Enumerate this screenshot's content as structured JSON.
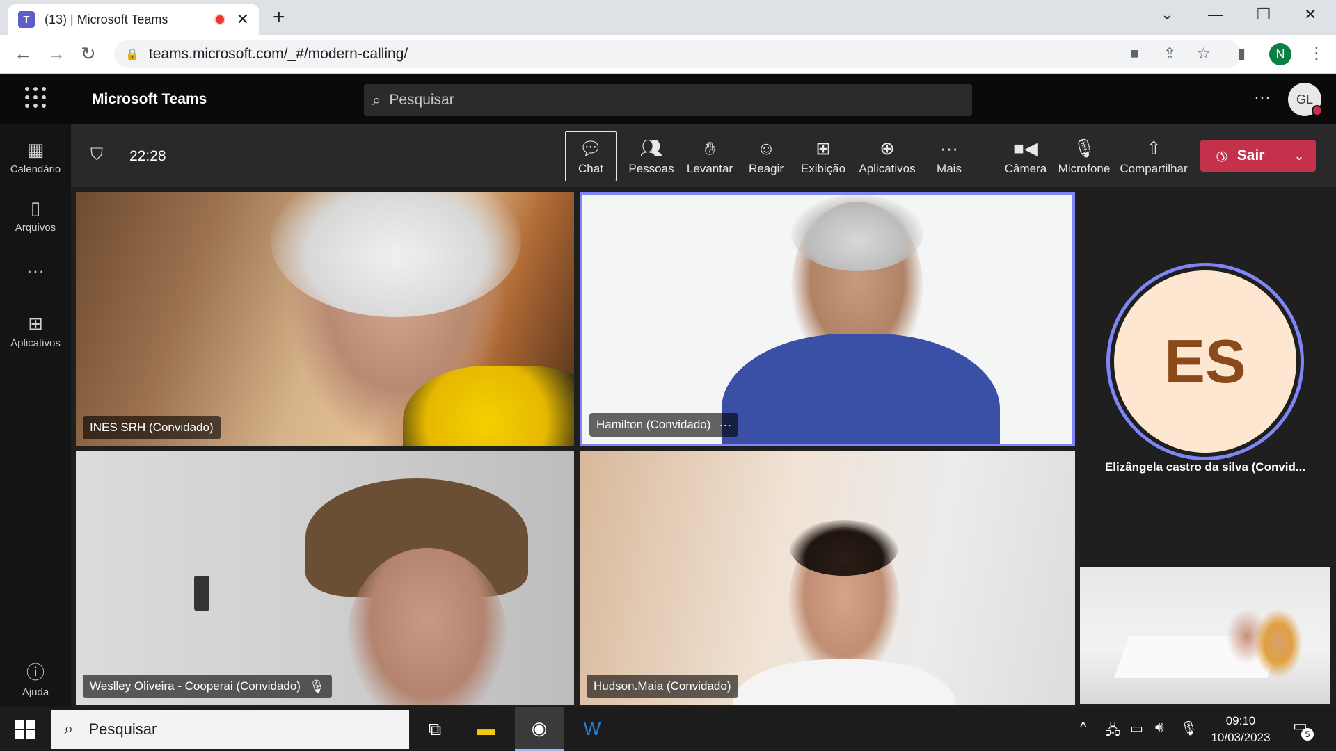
{
  "browser": {
    "tab_title": "(13) | Microsoft Teams",
    "url": "teams.microsoft.com/_#/modern-calling/",
    "profile_initial": "N"
  },
  "teams": {
    "app_name": "Microsoft Teams",
    "search_placeholder": "Pesquisar",
    "user_initials": "GL"
  },
  "rail": {
    "items": [
      {
        "label": "Calendário",
        "icon": "calendar-icon"
      },
      {
        "label": "Arquivos",
        "icon": "file-icon"
      },
      {
        "label": "",
        "icon": "more-icon"
      },
      {
        "label": "Aplicativos",
        "icon": "apps-icon"
      },
      {
        "label": "Ajuda",
        "icon": "help-icon"
      }
    ]
  },
  "call": {
    "timer": "22:28",
    "controls": {
      "chat": "Chat",
      "people": "Pessoas",
      "raise": "Levantar",
      "react": "Reagir",
      "view": "Exibição",
      "apps": "Aplicativos",
      "more": "Mais",
      "camera": "Câmera",
      "mic": "Microfone",
      "share": "Compartilhar"
    },
    "leave_label": "Sair"
  },
  "participants": {
    "ines": "INES SRH (Convidado)",
    "hamilton": "Hamilton (Convidado)",
    "weslley": "Weslley Oliveira - Cooperai (Convidado)",
    "hudson": "Hudson.Maia (Convidado)",
    "elizangela_initials": "ES",
    "elizangela": "Elizângela castro da silva (Convid..."
  },
  "taskbar": {
    "search_text": "Pesquisar",
    "time": "09:10",
    "date": "10/03/2023",
    "notification_count": "5"
  },
  "colors": {
    "accent": "#7f85f5",
    "leave": "#c4314b",
    "teams_purple": "#5b5fc7"
  }
}
